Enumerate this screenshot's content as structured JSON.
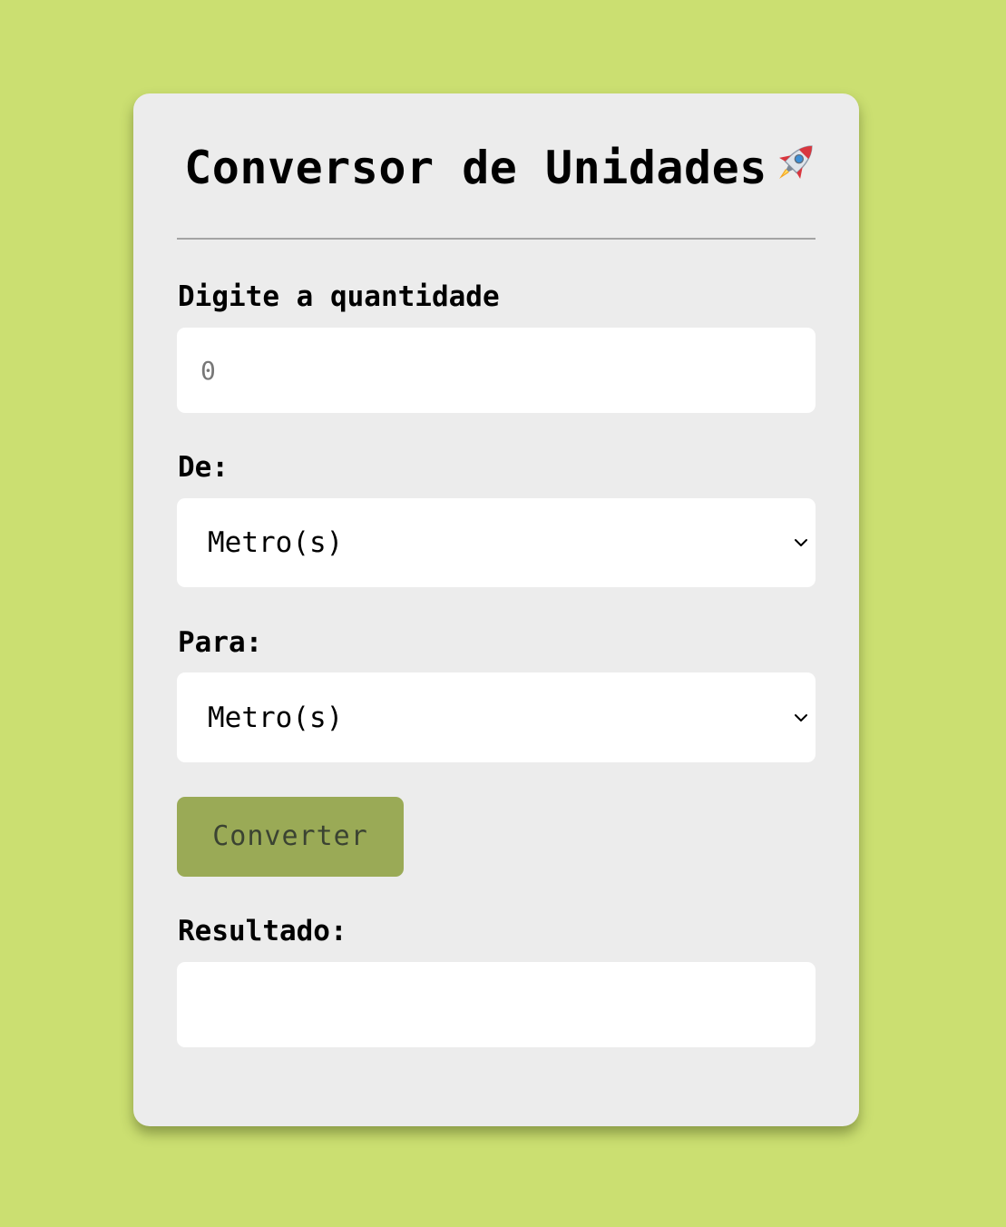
{
  "app": {
    "title": "Conversor de Unidades"
  },
  "form": {
    "quantity_label": "Digite a quantidade",
    "quantity_placeholder": "0",
    "quantity_value": "",
    "from_label": "De:",
    "from_selected": "Metro(s)",
    "to_label": "Para:",
    "to_selected": "Metro(s)",
    "convert_button": "Converter",
    "result_label": "Resultado:",
    "result_value": ""
  },
  "icons": {
    "title_icon": "rocket-icon",
    "select_icon": "chevron-down-icon"
  },
  "colors": {
    "background": "#cbdf71",
    "card": "#ececec",
    "button": "#9aaa56",
    "button_text": "#3b4332",
    "field": "#ffffff"
  }
}
